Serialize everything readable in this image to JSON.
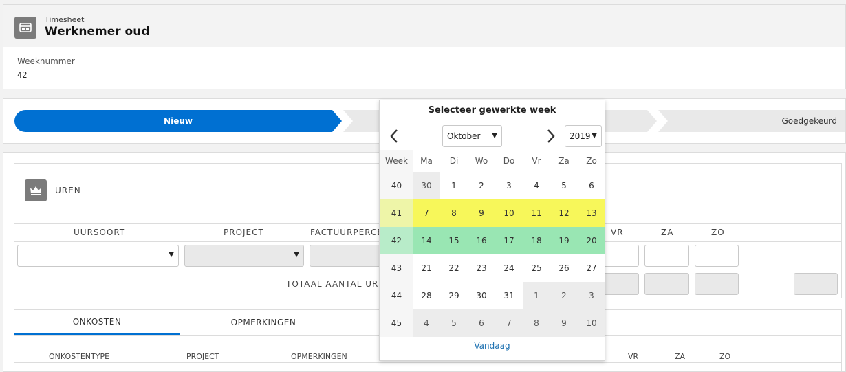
{
  "header": {
    "subtitle": "Timesheet",
    "title": "Werknemer oud",
    "icon": "card-icon"
  },
  "weeknummer": {
    "label": "Weeknummer",
    "value": "42"
  },
  "stages": [
    {
      "label": "Nieuw",
      "active": true
    },
    {
      "label": "",
      "active": false
    },
    {
      "label": "Goedgekeurd",
      "active": false
    }
  ],
  "uren": {
    "title": "UREN",
    "icon": "crown-icon",
    "columns": [
      "UURSOORT",
      "PROJECT",
      "FACTUURPERCE",
      "VR",
      "ZA",
      "ZO"
    ],
    "totaal_label": "TOTAAL AANTAL URE"
  },
  "tabs": [
    "ONKOSTEN",
    "OPMERKINGEN"
  ],
  "onkosten_columns": [
    "ONKOSTENTYPE",
    "PROJECT",
    "OPMERKINGEN",
    "VR",
    "ZA",
    "ZO"
  ],
  "picker": {
    "title": "Selecteer gewerkte week",
    "month": "Oktober",
    "year": "2019",
    "day_headers": [
      "Week",
      "Ma",
      "Di",
      "Wo",
      "Do",
      "Vr",
      "Za",
      "Zo"
    ],
    "weeks": [
      {
        "week": "40",
        "days": [
          "30",
          "1",
          "2",
          "3",
          "4",
          "5",
          "6"
        ]
      },
      {
        "week": "41",
        "days": [
          "7",
          "8",
          "9",
          "10",
          "11",
          "12",
          "13"
        ]
      },
      {
        "week": "42",
        "days": [
          "14",
          "15",
          "16",
          "17",
          "18",
          "19",
          "20"
        ]
      },
      {
        "week": "43",
        "days": [
          "21",
          "22",
          "23",
          "24",
          "25",
          "26",
          "27"
        ]
      },
      {
        "week": "44",
        "days": [
          "28",
          "29",
          "30",
          "31",
          "1",
          "2",
          "3"
        ]
      },
      {
        "week": "45",
        "days": [
          "4",
          "5",
          "6",
          "7",
          "8",
          "9",
          "10"
        ]
      }
    ],
    "today_label": "Vandaag"
  },
  "colors": {
    "accent": "#0070d2",
    "hover_week": "#f7f75a",
    "selected_week": "#99e6b3"
  }
}
